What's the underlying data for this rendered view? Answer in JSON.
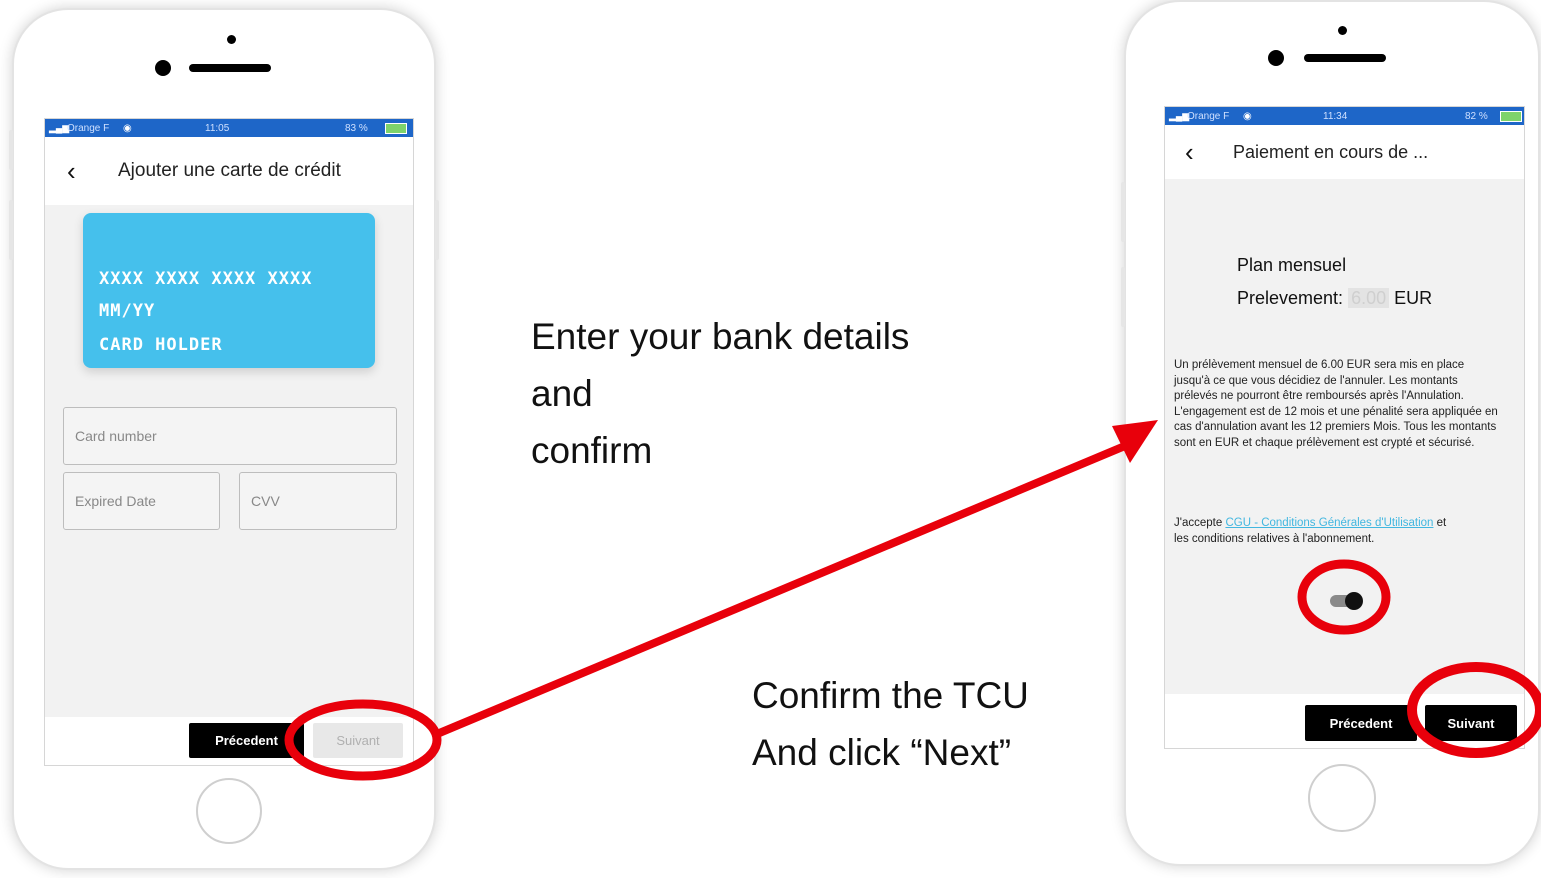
{
  "left_phone": {
    "status": {
      "carrier": "Orange F",
      "time": "11:05",
      "battery": "83 %"
    },
    "title": "Ajouter une carte de crédit",
    "card": {
      "number": "XXXX XXXX XXXX XXXX",
      "expiry": "MM/YY",
      "holder": "CARD HOLDER"
    },
    "fields": {
      "card_number": "Card number",
      "expired_date": "Expired Date",
      "cvv": "CVV"
    },
    "buttons": {
      "previous": "Précedent",
      "next": "Suivant"
    }
  },
  "right_phone": {
    "status": {
      "carrier": "Orange F",
      "time": "11:34",
      "battery": "82 %"
    },
    "title": "Paiement en cours de ...",
    "plan": "Plan mensuel",
    "prelevement_label": "Prelevement:",
    "prelevement_amount": "6.00",
    "prelevement_currency": "EUR",
    "description": "Un prélèvement mensuel de 6.00 EUR sera mis en place jusqu'à ce que vous décidiez de l'annuler. Les montants prélevés ne pourront être remboursés après l'Annulation. L'engagement est de 12 mois et une pénalité sera appliquée en cas d'annulation avant les 12 premiers Mois. Tous les montants sont en EUR et chaque prélèvement est crypté et sécurisé.",
    "accept_prefix": "J'accepte",
    "accept_link": "CGU - Conditions Générales d'Utilisation",
    "accept_suffix": "et les conditions relatives à l'abonnement.",
    "toggle_on": true,
    "buttons": {
      "previous": "Précedent",
      "next": "Suivant"
    }
  },
  "instructions": {
    "enter_line1": "Enter your bank details",
    "enter_line2": "and",
    "enter_line3": "confirm",
    "confirm_line1": "Confirm the TCU",
    "confirm_line2": "And click “Next”"
  },
  "colors": {
    "annotation_red": "#e8000b",
    "status_blue": "#1e66c8",
    "card_blue": "#45c0ec",
    "link": "#42b7e0"
  }
}
